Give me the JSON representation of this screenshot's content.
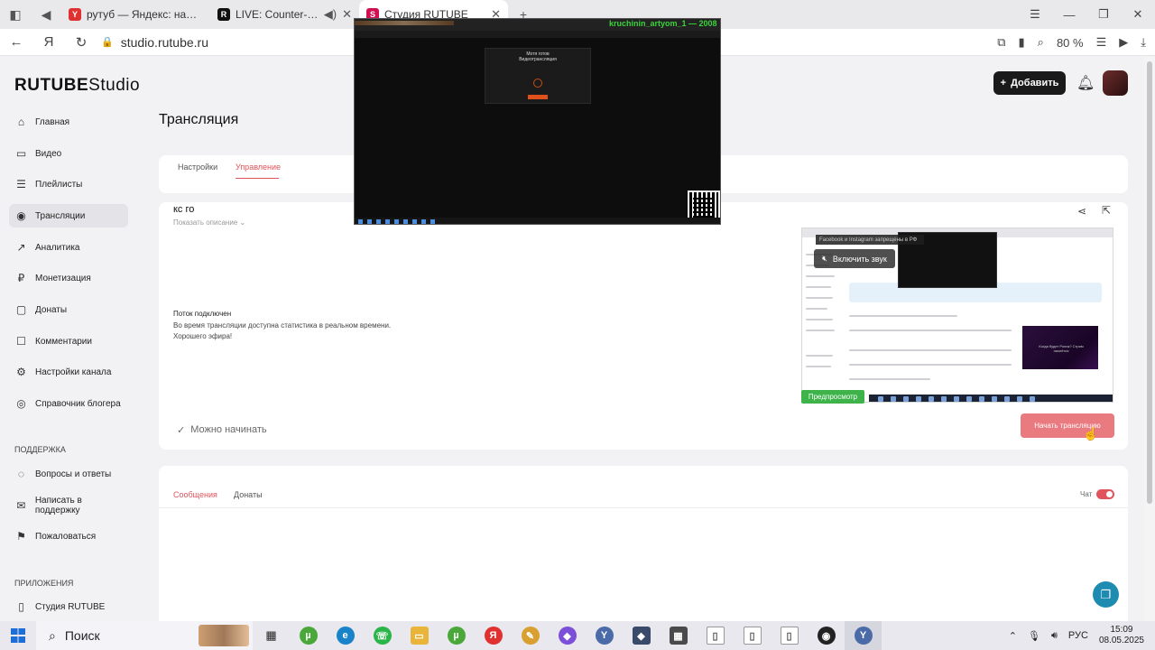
{
  "browser": {
    "tabs": [
      {
        "label": "рутуб — Яндекс: нашлось",
        "favicon": "Y",
        "favicon_color": "#e03030"
      },
      {
        "label": "LIVE: Counter-Strike",
        "favicon": "R",
        "favicon_color": "#101010"
      },
      {
        "label": "Студия RUTUBE",
        "favicon": "S",
        "favicon_color": "#d01050"
      }
    ],
    "url": "studio.rutube.ru",
    "zoom": "80 %"
  },
  "app": {
    "logo_main": "RUTUBE",
    "logo_studio": "Studio",
    "add_button": "Добавить",
    "page_title": "Трансляция",
    "sidebar": {
      "items": [
        {
          "label": "Главная",
          "icon": "home-icon",
          "glyph": "⌂"
        },
        {
          "label": "Видео",
          "icon": "video-icon",
          "glyph": "▭"
        },
        {
          "label": "Плейлисты",
          "icon": "playlist-icon",
          "glyph": "☰"
        },
        {
          "label": "Трансляции",
          "icon": "broadcast-icon",
          "glyph": "◉"
        },
        {
          "label": "Аналитика",
          "icon": "analytics-icon",
          "glyph": "↗"
        },
        {
          "label": "Монетизация",
          "icon": "monetization-icon",
          "glyph": "₽"
        },
        {
          "label": "Донаты",
          "icon": "donate-icon",
          "glyph": "▢"
        },
        {
          "label": "Комментарии",
          "icon": "comments-icon",
          "glyph": "☐"
        },
        {
          "label": "Настройки канала",
          "icon": "settings-icon",
          "glyph": "⚙"
        },
        {
          "label": "Справочник блогера",
          "icon": "book-icon",
          "glyph": "◎"
        }
      ],
      "support_header": "ПОДДЕРЖКА",
      "support_items": [
        {
          "label": "Вопросы и ответы",
          "icon": "faq-icon",
          "glyph": "◌"
        },
        {
          "label": "Написать в поддержку",
          "icon": "mail-icon",
          "glyph": "✉"
        },
        {
          "label": "Пожаловаться",
          "icon": "flag-icon",
          "glyph": "⚑"
        }
      ],
      "apps_header": "ПРИЛОЖЕНИЯ",
      "apps_items": [
        {
          "label": "Студия RUTUBE",
          "icon": "phone-icon",
          "glyph": "▯"
        }
      ]
    },
    "subtabs": [
      "Настройки",
      "Управление"
    ],
    "stream": {
      "name": "кс го",
      "show_description": "Показать описание",
      "status_title": "Поток подключен",
      "status_line1": "Во время трансляции доступна статистика в реальном времени.",
      "status_line2": "Хорошего эфира!",
      "ready": "Можно начинать",
      "start_button": "Начать трансляцию",
      "unmute": "Включить звук",
      "preview_label": "Предпросмотр",
      "preview_ribbon": "Facebook и Instagram запрещены в РФ",
      "preview_thumb_text": "Когда будет Ролик? Стрим начнётся"
    },
    "chat": {
      "tabs": [
        "Сообщения",
        "Донаты"
      ],
      "toggle_label": "Чат"
    }
  },
  "capture_window": {
    "user": "kruchinin_artyom_1 — 2008",
    "panel_title": "Мотя готов",
    "panel_sub": "Видеотрансляция"
  },
  "taskbar": {
    "search": "Поиск",
    "lang": "РУС",
    "time": "15:09",
    "date": "08.05.2025"
  }
}
